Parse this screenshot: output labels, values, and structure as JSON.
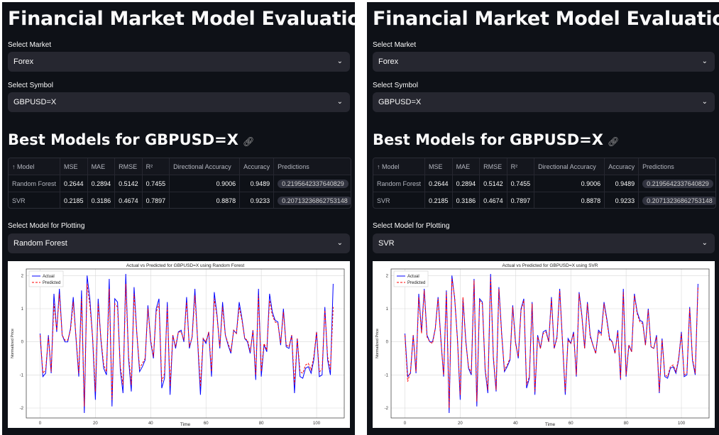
{
  "panes": [
    {
      "title": "Financial Market Model Evaluation",
      "market_label": "Select Market",
      "market_value": "Forex",
      "symbol_label": "Select Symbol",
      "symbol_value": "GBPUSD=X",
      "best_models_heading": "Best Models for GBPUSD=X",
      "table": {
        "columns": [
          "↑ Model",
          "MSE",
          "MAE",
          "RMSE",
          "R²",
          "Directional Accuracy",
          "Accuracy",
          "Predictions"
        ],
        "rows": [
          [
            "Random Forest",
            "0.2644",
            "0.2894",
            "0.5142",
            "0.7455",
            "0.9006",
            "0.9489",
            "0.2195642337640829"
          ],
          [
            "SVR",
            "0.2185",
            "0.3186",
            "0.4674",
            "0.7897",
            "0.8878",
            "0.9233",
            "0.20713236862753148"
          ]
        ]
      },
      "plot_label": "Select Model for Plotting",
      "plot_value": "Random Forest"
    },
    {
      "title": "Financial Market Model Evaluation",
      "market_label": "Select Market",
      "market_value": "Forex",
      "symbol_label": "Select Symbol",
      "symbol_value": "GBPUSD=X",
      "best_models_heading": "Best Models for GBPUSD=X",
      "table": {
        "columns": [
          "↑ Model",
          "MSE",
          "MAE",
          "RMSE",
          "R²",
          "Directional Accuracy",
          "Accuracy",
          "Predictions"
        ],
        "rows": [
          [
            "Random Forest",
            "0.2644",
            "0.2894",
            "0.5142",
            "0.7455",
            "0.9006",
            "0.9489",
            "0.2195642337640829"
          ],
          [
            "SVR",
            "0.2185",
            "0.3186",
            "0.4674",
            "0.7897",
            "0.8878",
            "0.9233",
            "0.20713236862753148"
          ]
        ]
      },
      "plot_label": "Select Model for Plotting",
      "plot_value": "SVR"
    }
  ],
  "icons": {
    "dropdown": "chevron-down-icon",
    "anchor": "link-icon"
  },
  "colors": {
    "background": "#0e1117",
    "select_bg": "#262730",
    "actual_line": "#0000ff",
    "predicted_line": "#ff0000"
  },
  "chart_data": [
    {
      "type": "line",
      "title": "Actual vs Predicted for GBPUSD=X using Random Forest",
      "xlabel": "Time",
      "ylabel": "Normalized Price",
      "xlim": [
        -5,
        110
      ],
      "ylim": [
        -2.3,
        2.2
      ],
      "xticks": [
        0,
        20,
        40,
        60,
        80,
        100
      ],
      "yticks": [
        -2,
        -1,
        0,
        1,
        2
      ],
      "grid": true,
      "legend": "top-left",
      "series": [
        {
          "name": "Actual",
          "style": "solid",
          "color": "#0000ff",
          "values": [
            0.25,
            -1.05,
            -0.95,
            0.2,
            -0.95,
            1.45,
            0.3,
            1.6,
            0.2,
            0.0,
            0.0,
            0.4,
            1.35,
            0.1,
            -1.05,
            1.55,
            -2.15,
            2.0,
            1.3,
            0.1,
            -1.75,
            1.3,
            0.05,
            -0.8,
            -1.0,
            1.9,
            -1.95,
            1.3,
            1.2,
            -0.85,
            -1.55,
            2.05,
            -0.5,
            -1.5,
            1.65,
            0.25,
            -0.9,
            -0.75,
            -0.55,
            1.1,
            0.0,
            -0.5,
            1.0,
            1.3,
            -1.4,
            -1.1,
            1.2,
            -1.6,
            0.2,
            -0.2,
            0.3,
            0.35,
            0.0,
            1.35,
            -0.2,
            0.15,
            1.6,
            0.0,
            -1.6,
            0.1,
            -0.05,
            0.3,
            -1.05,
            1.5,
            0.8,
            -0.2,
            1.2,
            0.2,
            -0.1,
            -0.35,
            0.35,
            0.25,
            1.2,
            0.7,
            0.1,
            0.0,
            -0.35,
            0.35,
            -1.15,
            1.6,
            -1.05,
            -0.1,
            -0.3,
            1.45,
            0.9,
            0.65,
            0.6,
            -0.1,
            1.0,
            -0.15,
            -0.2,
            0.2,
            -1.55,
            0.1,
            -1.05,
            -1.1,
            -0.8,
            -0.75,
            -0.95,
            -0.55,
            0.3,
            -1.05,
            -1.0,
            1.05,
            -0.55,
            -1.0,
            1.75
          ]
        },
        {
          "name": "Predicted",
          "style": "dashed",
          "color": "#ff0000",
          "values": [
            0.2,
            -0.95,
            -0.85,
            0.15,
            -0.9,
            1.15,
            0.35,
            1.45,
            0.2,
            0.05,
            0.05,
            0.35,
            1.2,
            0.15,
            -0.95,
            1.3,
            -1.95,
            1.75,
            1.1,
            0.15,
            -1.5,
            1.15,
            0.1,
            -0.7,
            -0.9,
            1.6,
            -1.75,
            1.15,
            1.05,
            -0.75,
            -1.3,
            1.75,
            -0.4,
            -1.3,
            1.45,
            0.25,
            -0.8,
            -0.65,
            -0.5,
            1.0,
            0.05,
            -0.45,
            0.9,
            1.15,
            -1.2,
            -0.95,
            1.05,
            -1.35,
            0.2,
            -0.15,
            0.3,
            0.3,
            0.05,
            1.2,
            -0.15,
            0.15,
            1.4,
            0.05,
            -1.35,
            0.1,
            0.0,
            0.3,
            -0.9,
            1.3,
            0.75,
            -0.15,
            1.05,
            0.2,
            -0.05,
            -0.3,
            0.35,
            0.25,
            1.05,
            0.65,
            0.1,
            0.05,
            -0.3,
            0.35,
            -1.0,
            1.4,
            -0.9,
            -0.05,
            -0.25,
            1.25,
            0.8,
            0.6,
            0.55,
            -0.05,
            0.9,
            -0.1,
            -0.15,
            0.2,
            -1.3,
            0.1,
            -0.9,
            -0.95,
            -0.7,
            -0.65,
            -0.85,
            -0.45,
            0.3,
            -0.9,
            -0.85,
            0.95,
            -0.45,
            -0.85,
            1.05
          ]
        }
      ]
    },
    {
      "type": "line",
      "title": "Actual vs Predicted for GBPUSD=X using SVR",
      "xlabel": "Time",
      "ylabel": "Normalized Price",
      "xlim": [
        -5,
        110
      ],
      "ylim": [
        -2.3,
        2.2
      ],
      "xticks": [
        0,
        20,
        40,
        60,
        80,
        100
      ],
      "yticks": [
        -2,
        -1,
        0,
        1,
        2
      ],
      "grid": true,
      "legend": "top-left",
      "series": [
        {
          "name": "Actual",
          "style": "solid",
          "color": "#0000ff",
          "values": [
            0.25,
            -1.05,
            -0.95,
            0.2,
            -0.95,
            1.45,
            0.3,
            1.6,
            0.2,
            0.0,
            0.0,
            0.4,
            1.35,
            0.1,
            -1.05,
            1.55,
            -2.15,
            2.0,
            1.3,
            0.1,
            -1.75,
            1.3,
            0.05,
            -0.8,
            -1.0,
            1.9,
            -1.95,
            1.3,
            1.2,
            -0.85,
            -1.55,
            2.05,
            -0.5,
            -1.5,
            1.65,
            0.25,
            -0.9,
            -0.75,
            -0.55,
            1.1,
            0.0,
            -0.5,
            1.0,
            1.3,
            -1.4,
            -1.1,
            1.2,
            -1.6,
            0.2,
            -0.2,
            0.3,
            0.35,
            0.0,
            1.35,
            -0.2,
            0.15,
            1.6,
            0.0,
            -1.6,
            0.1,
            -0.05,
            0.3,
            -1.05,
            1.5,
            0.8,
            -0.2,
            1.2,
            0.2,
            -0.1,
            -0.35,
            0.35,
            0.25,
            1.2,
            0.7,
            0.1,
            0.0,
            -0.35,
            0.35,
            -1.15,
            1.6,
            -1.05,
            -0.1,
            -0.3,
            1.45,
            0.9,
            0.65,
            0.6,
            -0.1,
            1.0,
            -0.15,
            -0.2,
            0.2,
            -1.55,
            0.1,
            -1.05,
            -1.1,
            -0.8,
            -0.75,
            -0.95,
            -0.55,
            0.3,
            -1.05,
            -1.0,
            1.05,
            -0.55,
            -1.0,
            1.75
          ]
        },
        {
          "name": "Predicted",
          "style": "dashed",
          "color": "#ff0000",
          "values": [
            0.2,
            -1.2,
            -0.9,
            0.2,
            -0.9,
            1.35,
            0.25,
            1.55,
            0.15,
            0.0,
            -0.05,
            0.4,
            1.3,
            0.05,
            -1.0,
            1.5,
            -2.0,
            1.9,
            1.35,
            0.05,
            -1.6,
            1.35,
            0.0,
            -0.75,
            -0.95,
            1.85,
            -1.8,
            1.25,
            1.15,
            -0.8,
            -1.45,
            1.95,
            -0.45,
            -1.45,
            1.6,
            0.2,
            -0.85,
            -0.7,
            -0.5,
            1.05,
            -0.05,
            -0.45,
            0.95,
            1.25,
            -1.3,
            -1.05,
            1.15,
            -1.5,
            0.15,
            -0.2,
            0.25,
            0.3,
            0.0,
            1.3,
            -0.2,
            0.1,
            1.55,
            0.0,
            -1.5,
            0.05,
            -0.05,
            0.25,
            -1.0,
            1.45,
            0.75,
            -0.2,
            1.15,
            0.15,
            -0.1,
            -0.35,
            0.3,
            0.2,
            1.15,
            0.65,
            0.05,
            0.0,
            -0.35,
            0.3,
            -1.1,
            1.5,
            -1.0,
            -0.1,
            -0.3,
            1.4,
            0.85,
            0.6,
            0.55,
            -0.1,
            0.95,
            -0.15,
            -0.2,
            0.15,
            -1.5,
            0.05,
            -1.0,
            -1.05,
            -0.75,
            -0.7,
            -0.9,
            -0.5,
            0.25,
            -1.0,
            -0.95,
            1.0,
            -0.5,
            -0.95,
            1.65
          ]
        }
      ]
    }
  ]
}
